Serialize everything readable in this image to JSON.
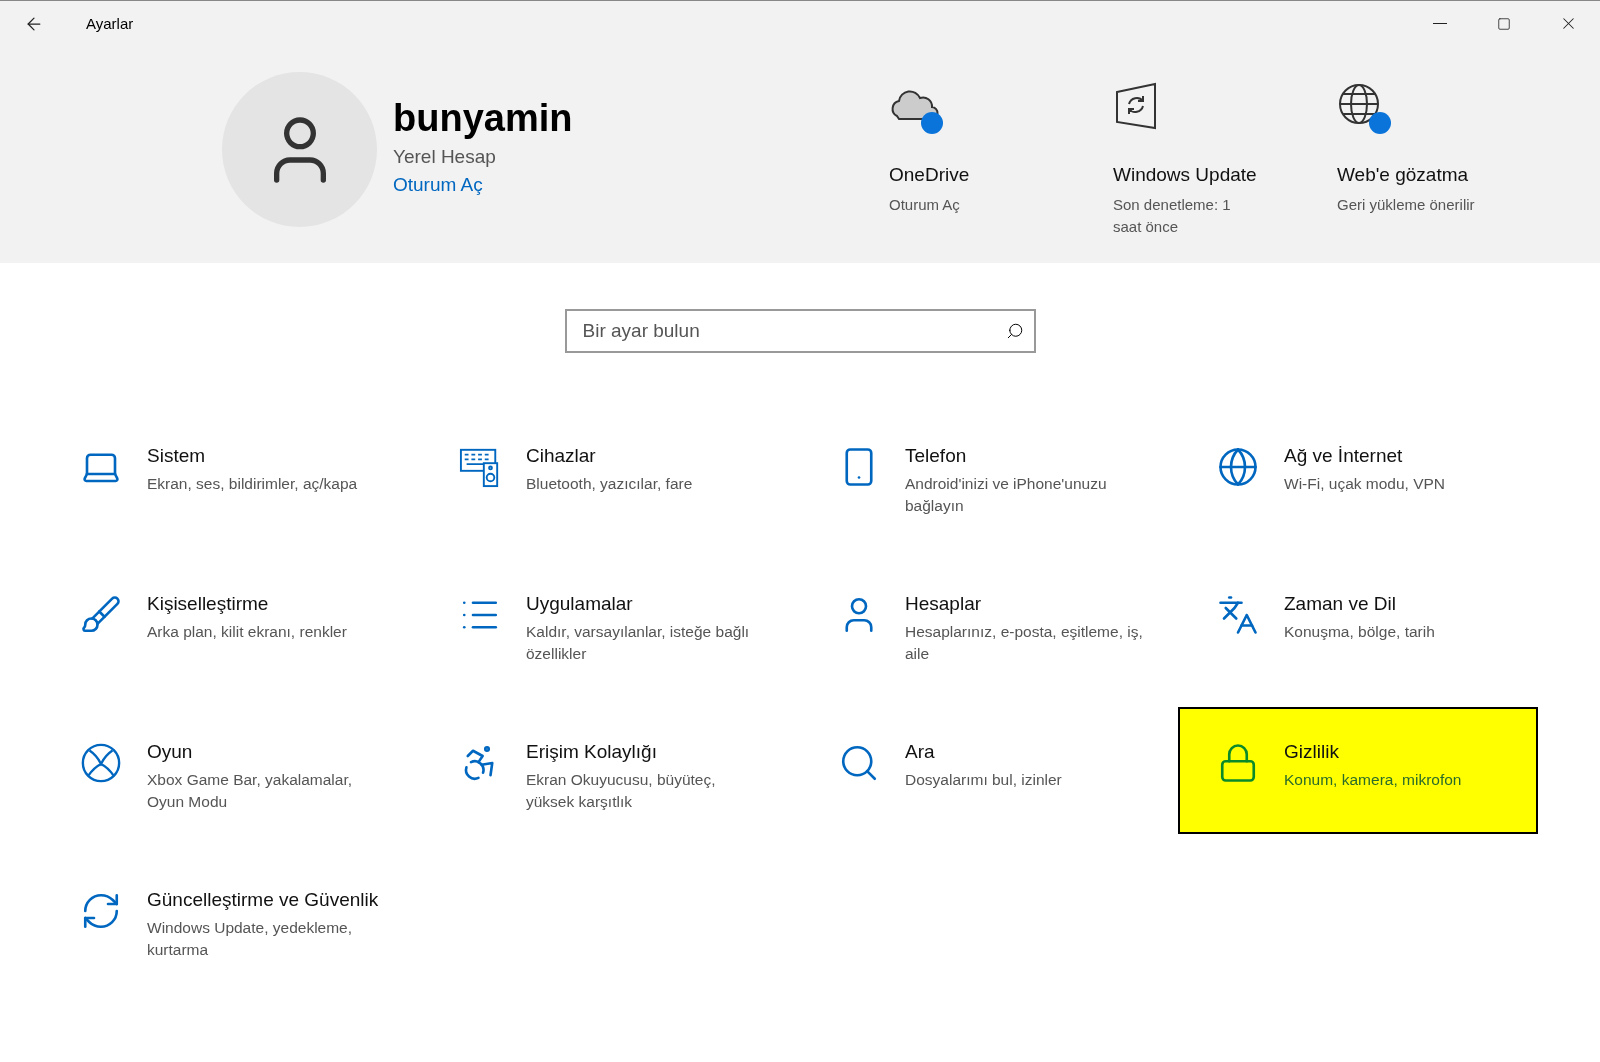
{
  "window": {
    "title": "Ayarlar"
  },
  "account": {
    "name": "bunyamin",
    "type": "Yerel Hesap",
    "link": "Oturum Aç"
  },
  "header_cards": [
    {
      "title": "OneDrive",
      "subtitle": "Oturum Aç",
      "badge": true
    },
    {
      "title": "Windows Update",
      "subtitle": "Son denetleme: 1 saat önce",
      "badge": false
    },
    {
      "title": "Web'e gözatma",
      "subtitle": "Geri yükleme önerilir",
      "badge": true
    }
  ],
  "search": {
    "placeholder": "Bir ayar bulun"
  },
  "categories": [
    {
      "title": "Sistem",
      "description": "Ekran, ses, bildirimler, aç/kapa",
      "highlighted": false
    },
    {
      "title": "Cihazlar",
      "description": "Bluetooth, yazıcılar, fare",
      "highlighted": false
    },
    {
      "title": "Telefon",
      "description": "Android'inizi ve iPhone'unuzu bağlayın",
      "highlighted": false
    },
    {
      "title": "Ağ ve İnternet",
      "description": "Wi-Fi, uçak modu, VPN",
      "highlighted": false
    },
    {
      "title": "Kişiselleştirme",
      "description": "Arka plan, kilit ekranı, renkler",
      "highlighted": false
    },
    {
      "title": "Uygulamalar",
      "description": "Kaldır, varsayılanlar, isteğe bağlı özellikler",
      "highlighted": false
    },
    {
      "title": "Hesaplar",
      "description": "Hesaplarınız, e-posta, eşitleme, iş, aile",
      "highlighted": false
    },
    {
      "title": "Zaman ve Dil",
      "description": "Konuşma, bölge, tarih",
      "highlighted": false
    },
    {
      "title": "Oyun",
      "description": "Xbox Game Bar, yakalamalar, Oyun Modu",
      "highlighted": false
    },
    {
      "title": "Erişim Kolaylığı",
      "description": "Ekran Okuyucusu, büyüteç, yüksek karşıtlık",
      "highlighted": false
    },
    {
      "title": "Ara",
      "description": "Dosyalarımı bul, izinler",
      "highlighted": false
    },
    {
      "title": "Gizlilik",
      "description": "Konum, kamera, mikrofon",
      "highlighted": true
    },
    {
      "title": "Güncelleştirme ve Güvenlik",
      "description": "Windows Update, yedekleme, kurtarma",
      "highlighted": false
    }
  ]
}
